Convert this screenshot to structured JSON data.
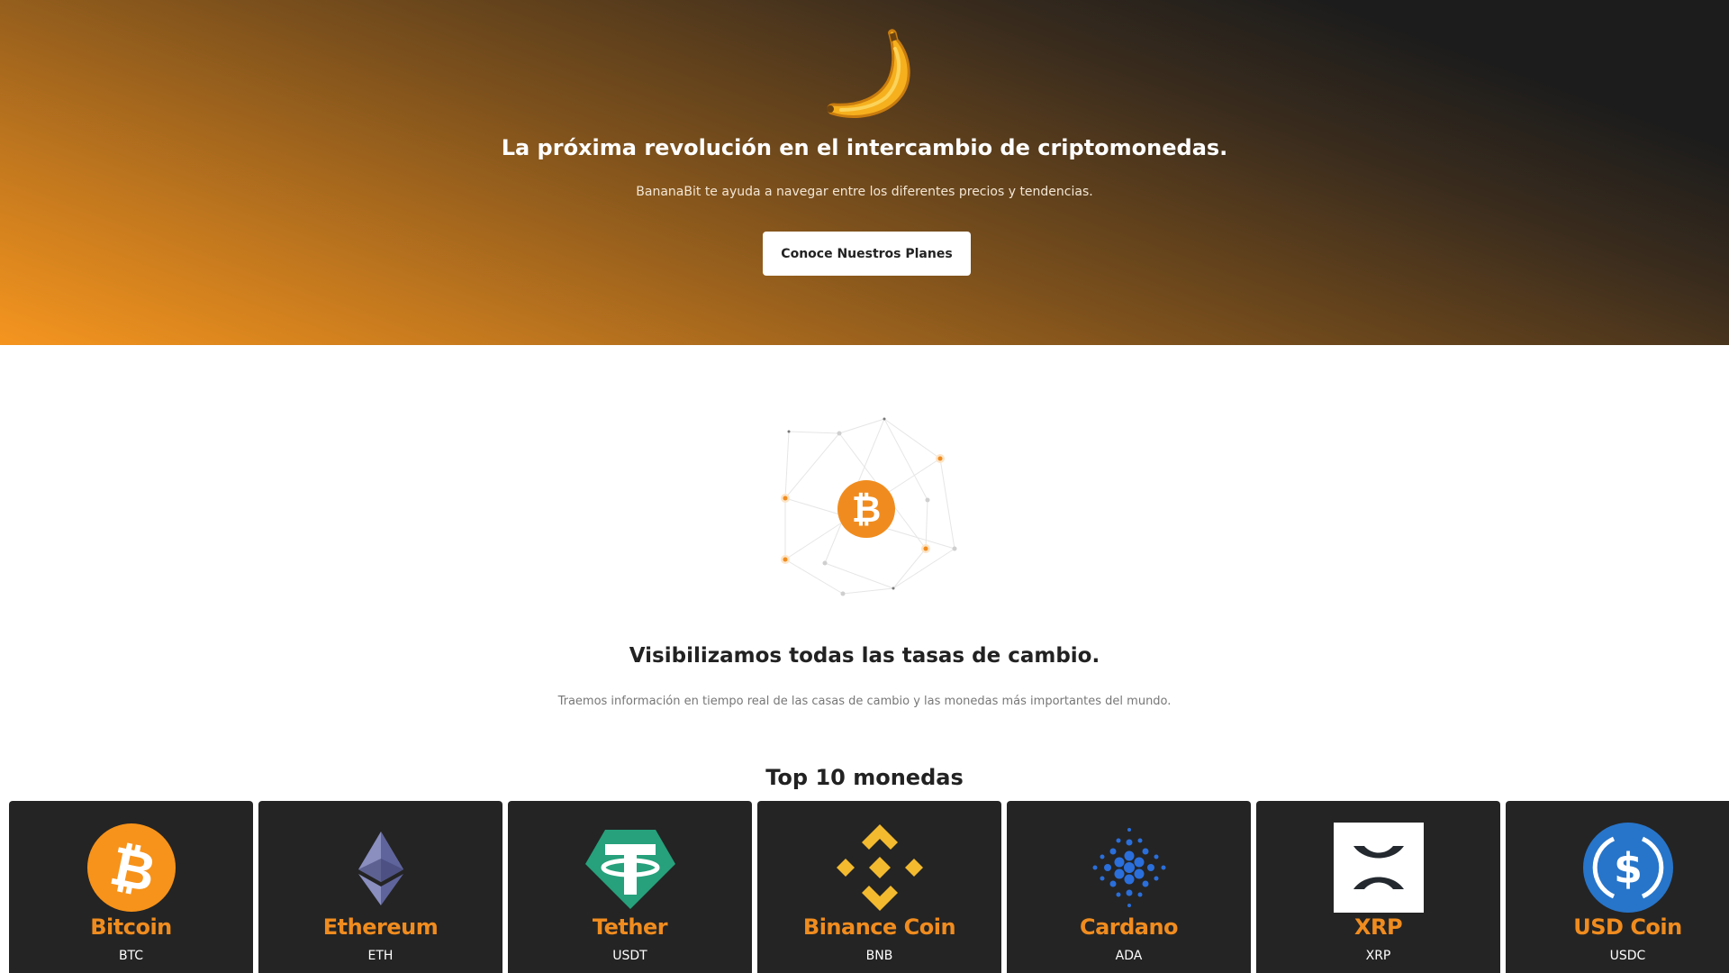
{
  "hero": {
    "banana_icon": "banana-emoji",
    "title": "La próxima revolución en el intercambio de criptomonedas.",
    "subtitle": "BananaBit te ayuda a navegar entre los diferentes precios y tendencias.",
    "cta_label": "Conoce Nuestros Planes"
  },
  "features": {
    "network_icon": "bitcoin-network-icon",
    "title": "Visibilizamos todas las tasas de cambio.",
    "text": "Traemos información en tiempo real de las casas de cambio y las monedas más importantes del mundo."
  },
  "top_coins": {
    "title": "Top 10 monedas",
    "items": [
      {
        "name": "Bitcoin",
        "symbol": "BTC",
        "icon": "bitcoin-icon"
      },
      {
        "name": "Ethereum",
        "symbol": "ETH",
        "icon": "ethereum-icon"
      },
      {
        "name": "Tether",
        "symbol": "USDT",
        "icon": "tether-icon"
      },
      {
        "name": "Binance Coin",
        "symbol": "BNB",
        "icon": "binance-icon"
      },
      {
        "name": "Cardano",
        "symbol": "ADA",
        "icon": "cardano-icon"
      },
      {
        "name": "XRP",
        "symbol": "XRP",
        "icon": "xrp-icon"
      },
      {
        "name": "USD Coin",
        "symbol": "USDC",
        "icon": "usdc-icon"
      }
    ]
  },
  "colors": {
    "accent": "#f08c1f",
    "card_bg": "#242424",
    "hero_start": "#f5951f",
    "hero_end": "#1c1c1c"
  }
}
